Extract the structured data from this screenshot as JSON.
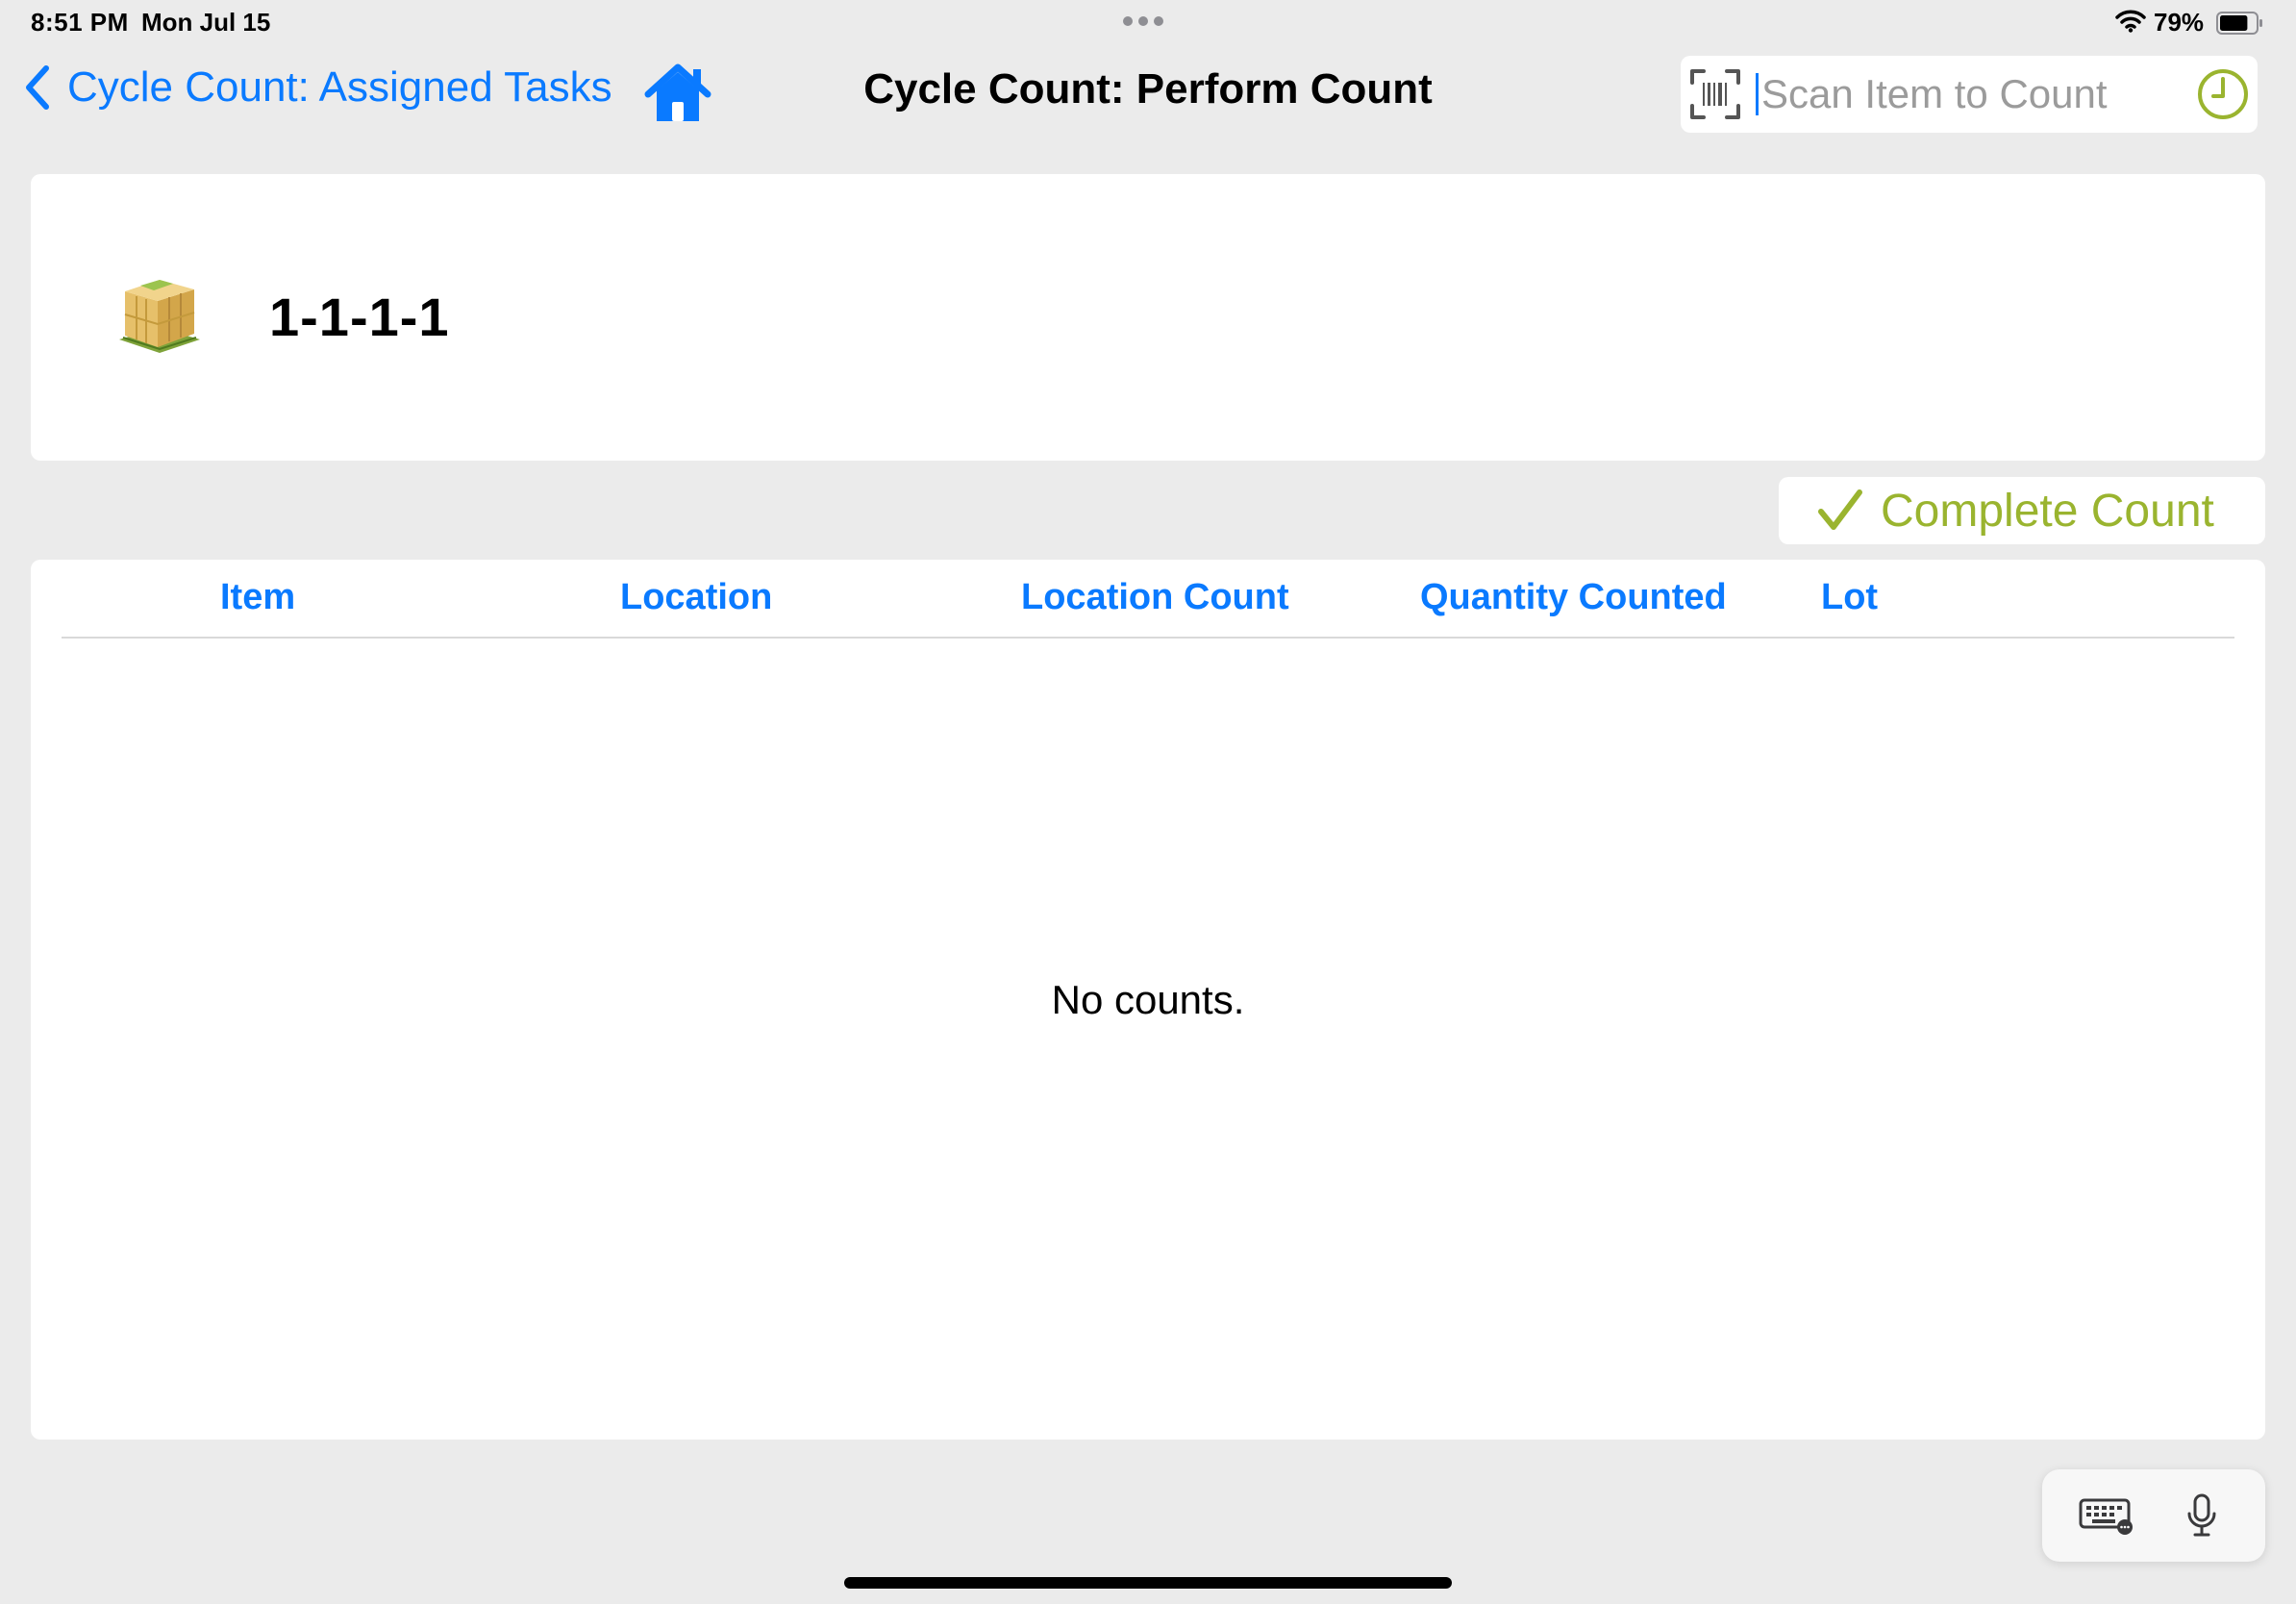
{
  "status_bar": {
    "time": "8:51 PM",
    "date": "Mon Jul 15",
    "battery_percent": "79%",
    "battery_level": 0.79
  },
  "nav": {
    "back_label": "Cycle Count: Assigned Tasks",
    "title": "Cycle Count: Perform Count",
    "scan_placeholder": "Scan Item to Count",
    "accent_color": "#0a7aff",
    "icons": [
      "chevron-left-icon",
      "home-icon",
      "barcode-scan-icon",
      "clock-icon"
    ]
  },
  "location": {
    "code": "1-1-1-1",
    "icon": "warehouse-box-icon"
  },
  "actions": {
    "complete_label": "Complete Count",
    "complete_color": "#9ab42f"
  },
  "table": {
    "columns": [
      "Item",
      "Location",
      "Location Count",
      "Quantity Counted",
      "Lot"
    ],
    "rows": [],
    "empty_message": "No counts."
  },
  "keyboard_bar": {
    "icons": [
      "keyboard-icon",
      "microphone-icon"
    ]
  }
}
